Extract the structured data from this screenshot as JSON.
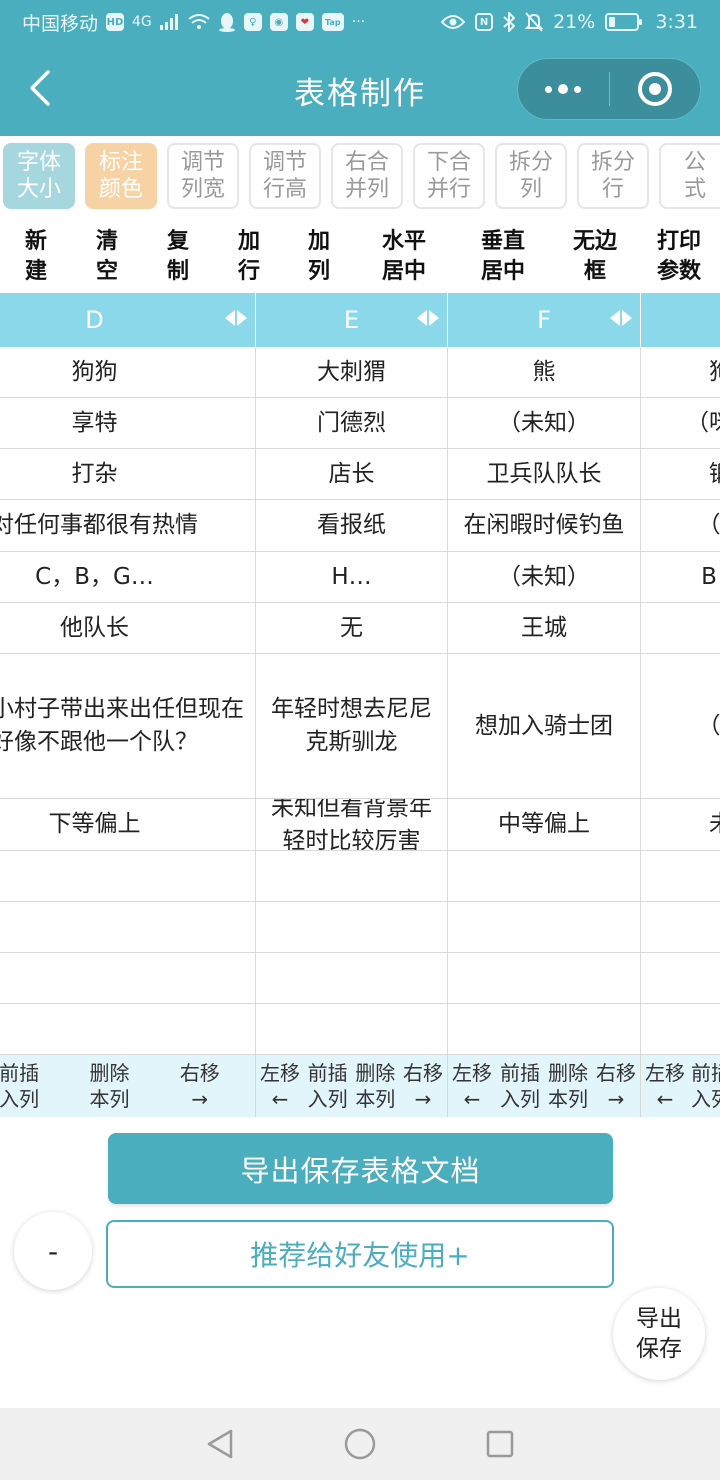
{
  "status": {
    "carrier": "中国移动",
    "hd": "HD",
    "network": "4G",
    "nfc": "N",
    "battery_pct": "21%",
    "battery_level": 0.21,
    "time": "3:31",
    "tap_label": "Tap"
  },
  "header": {
    "title": "表格制作",
    "colors": {
      "bar": "#4aaebf",
      "capsule": "#3d8e9c"
    }
  },
  "toolbar_top": [
    {
      "label": "字体\n大小",
      "style": "font"
    },
    {
      "label": "标注\n颜色",
      "style": "mark"
    },
    {
      "label": "调节\n列宽",
      "style": "plain"
    },
    {
      "label": "调节\n行高",
      "style": "plain"
    },
    {
      "label": "右合\n并列",
      "style": "plain"
    },
    {
      "label": "下合\n并行",
      "style": "plain"
    },
    {
      "label": "拆分\n列",
      "style": "plain"
    },
    {
      "label": "拆分\n行",
      "style": "plain"
    },
    {
      "label": "公\n式",
      "style": "plain"
    }
  ],
  "toolbar_actions": [
    {
      "label": "新\n建",
      "name": "new-button"
    },
    {
      "label": "清\n空",
      "name": "clear-button"
    },
    {
      "label": "复\n制",
      "name": "copy-button"
    },
    {
      "label": "加\n行",
      "name": "add-row-button"
    },
    {
      "label": "加\n列",
      "name": "add-column-button"
    },
    {
      "label": "水平\n居中",
      "name": "horizontal-center-button"
    },
    {
      "label": "垂直\n居中",
      "name": "vertical-center-button"
    },
    {
      "label": "无边\n框",
      "name": "no-border-button"
    },
    {
      "label": "打印\n参数",
      "name": "print-params-button"
    }
  ],
  "table": {
    "columns": [
      {
        "header": "D",
        "cells": [
          "狗狗",
          "享特",
          "打杂",
          "对任何事都很有热情",
          "C，B，G…",
          "他队长",
          "夫从小村子带出来出任但现在好像不跟他一个队？",
          "下等偏上",
          "",
          "",
          "",
          ""
        ],
        "footer": [
          "前插\n入列",
          "删除\n本列",
          "右移\n→"
        ]
      },
      {
        "header": "E",
        "cells": [
          "大刺猬",
          "门德烈",
          "店长",
          "看报纸",
          "H…",
          "无",
          "年轻时想去尼尼克斯驯龙",
          "未知但看背景年轻时比较厉害",
          "",
          "",
          "",
          ""
        ],
        "footer": [
          "左移\n←",
          "前插\n入列",
          "删除\n本列",
          "右移\n→"
        ]
      },
      {
        "header": "F",
        "cells": [
          "熊",
          "（未知）",
          "卫兵队队长",
          "在闲暇时候钓鱼",
          "（未知）",
          "王城",
          "想加入骑士团",
          "中等偏上",
          "",
          "",
          "",
          ""
        ],
        "footer": [
          "左移\n←",
          "前插\n入列",
          "删除\n本列",
          "右移\n→"
        ]
      },
      {
        "header": "",
        "cells": [
          "狗",
          "（咪咪",
          "锻",
          "（未",
          "B，",
          "",
          "（未",
          "未",
          "",
          "",
          "",
          ""
        ],
        "footer": [
          "左移\n←",
          "前插\n入列"
        ]
      }
    ]
  },
  "bottom": {
    "export_label": "导出保存表格文档",
    "recommend_label": "推荐给好友使用+",
    "minus_label": "-",
    "save_fab_label": "导出\n保存"
  }
}
